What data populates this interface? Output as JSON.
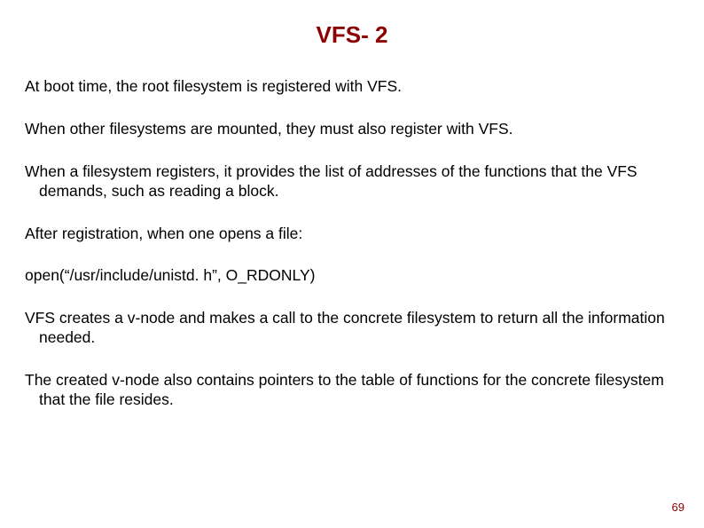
{
  "slide": {
    "title": "VFS- 2",
    "paragraphs": {
      "p1": "At boot time, the root filesystem is registered with VFS.",
      "p2": "When other filesystems are mounted, they must also register with VFS.",
      "p3": "When a filesystem registers, it provides the list of addresses of the functions that the VFS demands, such as reading a block.",
      "p4": "After registration, when one opens a file:",
      "p5": "open(“/usr/include/unistd. h”, O_RDONLY)",
      "p6": "VFS creates a v-node and makes a call to the concrete filesystem to return all the information needed.",
      "p7": "The created v-node also contains pointers to the table of functions for the concrete filesystem that the file resides."
    },
    "page_number": "69"
  }
}
